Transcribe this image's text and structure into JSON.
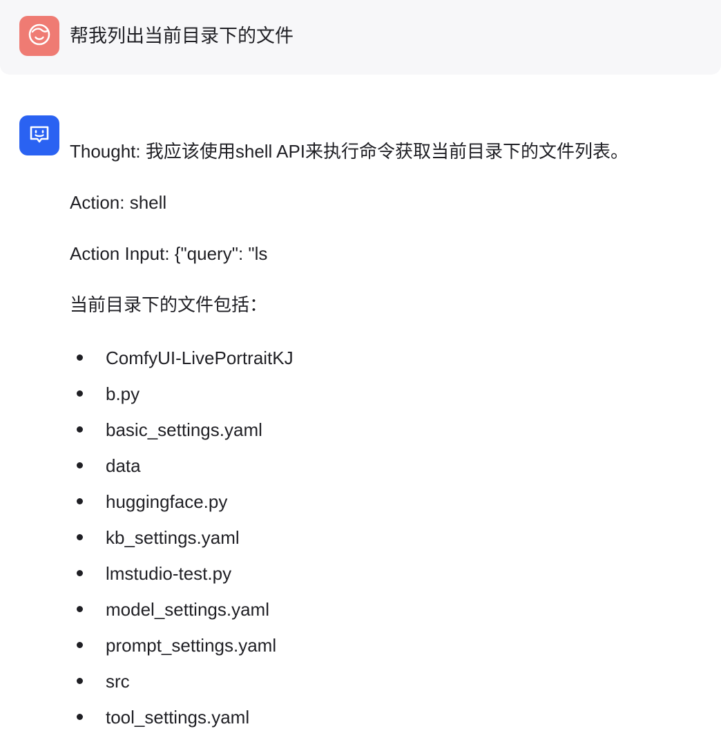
{
  "user_message": {
    "avatar_icon": "smiley-face-icon",
    "avatar_color": "#ef7b73",
    "text": "帮我列出当前目录下的文件"
  },
  "assistant_message": {
    "avatar_icon": "chat-bubble-smile-icon",
    "avatar_color": "#2a62f2",
    "thought": "Thought: 我应该使用shell API来执行命令获取当前目录下的文件列表。",
    "action": "Action: shell",
    "action_input": "Action Input: {\"query\": \"ls",
    "intro": "当前目录下的文件包括：",
    "files": [
      "ComfyUI-LivePortraitKJ",
      "b.py",
      "basic_settings.yaml",
      "data",
      "huggingface.py",
      "kb_settings.yaml",
      "lmstudio-test.py",
      "model_settings.yaml",
      "prompt_settings.yaml",
      "src",
      "tool_settings.yaml"
    ]
  }
}
